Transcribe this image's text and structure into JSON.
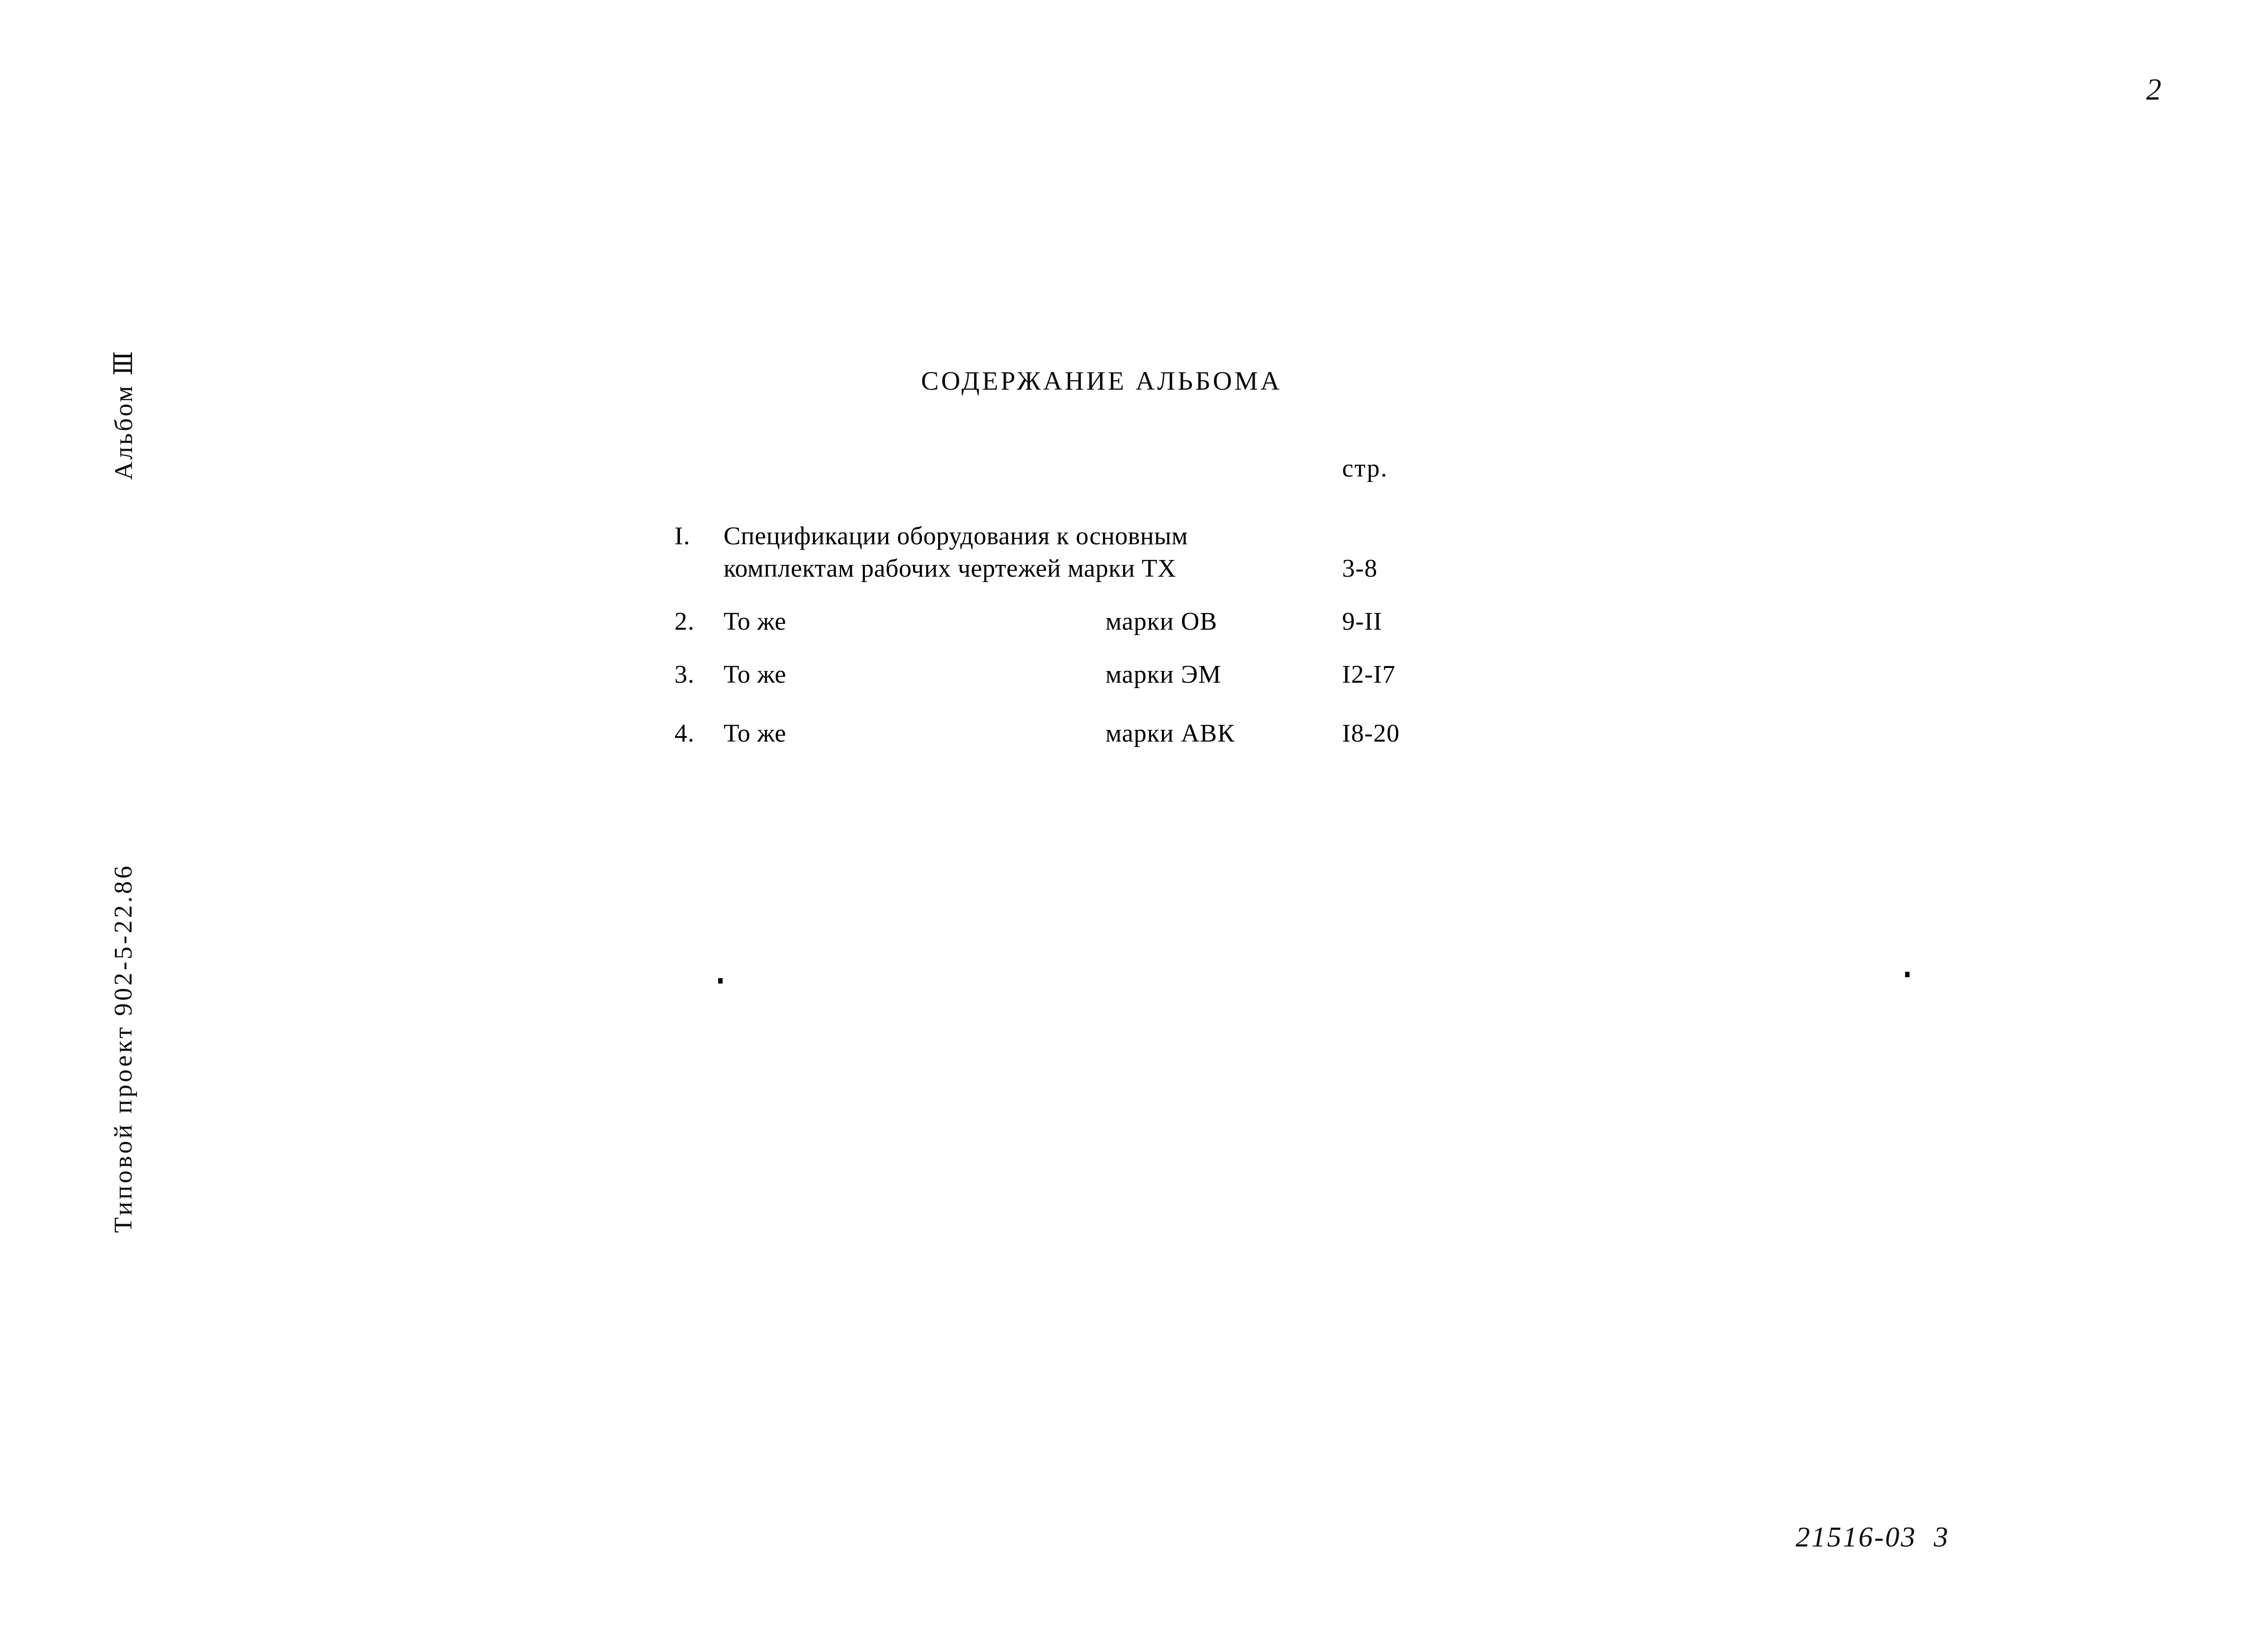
{
  "page": {
    "folio_number": "2",
    "background_color": "#ffffff",
    "text_color": "#000000"
  },
  "margin_stamps": {
    "album": "Альбом Ⅲ",
    "project": "Типовой проект 902-5-22.86"
  },
  "document": {
    "title": "СОДЕРЖАНИЕ АЛЬБОМА",
    "pages_column_header": "стр."
  },
  "contents": {
    "rows": [
      {
        "number": "I.",
        "title_line1": "Спецификации оборудования к основным",
        "title_line2": "комплектам рабочих чертежей марки ТХ",
        "mark": "",
        "pages": "3-8"
      },
      {
        "number": "2.",
        "title_line1": "То же",
        "title_line2": "",
        "mark": "марки ОВ",
        "pages": "9-II"
      },
      {
        "number": "3.",
        "title_line1": "То же",
        "title_line2": "",
        "mark": "марки ЭМ",
        "pages": "I2-I7"
      },
      {
        "number": "4.",
        "title_line1": "То же",
        "title_line2": "",
        "mark": "марки АВК",
        "pages": "I8-20"
      }
    ]
  },
  "archive": {
    "code": "21516-03  3"
  }
}
